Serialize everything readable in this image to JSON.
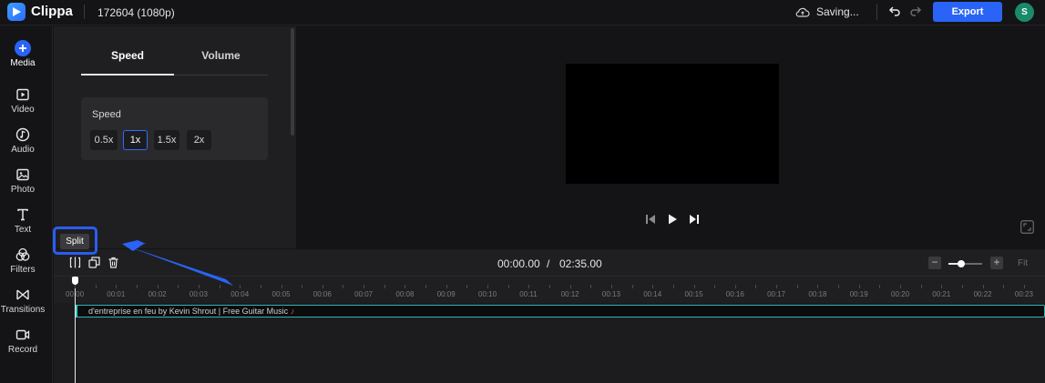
{
  "app": {
    "name": "Clippa",
    "project": "172604 (1080p)"
  },
  "header": {
    "status": "Saving...",
    "export_label": "Export",
    "avatar_initial": "S"
  },
  "nav": {
    "items": [
      {
        "label": "Media",
        "icon": "plus-circle-icon"
      },
      {
        "label": "Video",
        "icon": "video-icon"
      },
      {
        "label": "Audio",
        "icon": "music-note-icon"
      },
      {
        "label": "Photo",
        "icon": "image-icon"
      },
      {
        "label": "Text",
        "icon": "text-icon"
      },
      {
        "label": "Filters",
        "icon": "filters-icon"
      },
      {
        "label": "Transitions",
        "icon": "transitions-icon"
      },
      {
        "label": "Record",
        "icon": "record-icon"
      }
    ]
  },
  "panel": {
    "tabs": [
      "Speed",
      "Volume"
    ],
    "active_tab": "Speed",
    "speed_label": "Speed",
    "speed_options": [
      "0.5x",
      "1x",
      "1.5x",
      "2x"
    ],
    "selected_speed": "1x"
  },
  "tooltip": {
    "text": "Split"
  },
  "timeline": {
    "current_time": "00:00.00",
    "separator": "/",
    "total_time": "02:35.00",
    "fit_label": "Fit",
    "ruler_labels": [
      "00:00",
      "00:01",
      "00:02",
      "00:03",
      "00:04",
      "00:05",
      "00:06",
      "00:07",
      "00:08",
      "00:09",
      "00:10",
      "00:11",
      "00:12",
      "00:13",
      "00:14",
      "00:15",
      "00:16",
      "00:17",
      "00:18",
      "00:19",
      "00:20",
      "00:21",
      "00:22",
      "00:23"
    ],
    "clip_title": "d'entreprise en feu by Kevin Shrout | Free Guitar Music"
  },
  "colors": {
    "accent": "#2a64f6",
    "clip_border": "#2fb6b0",
    "avatar": "#1a8a6b"
  }
}
